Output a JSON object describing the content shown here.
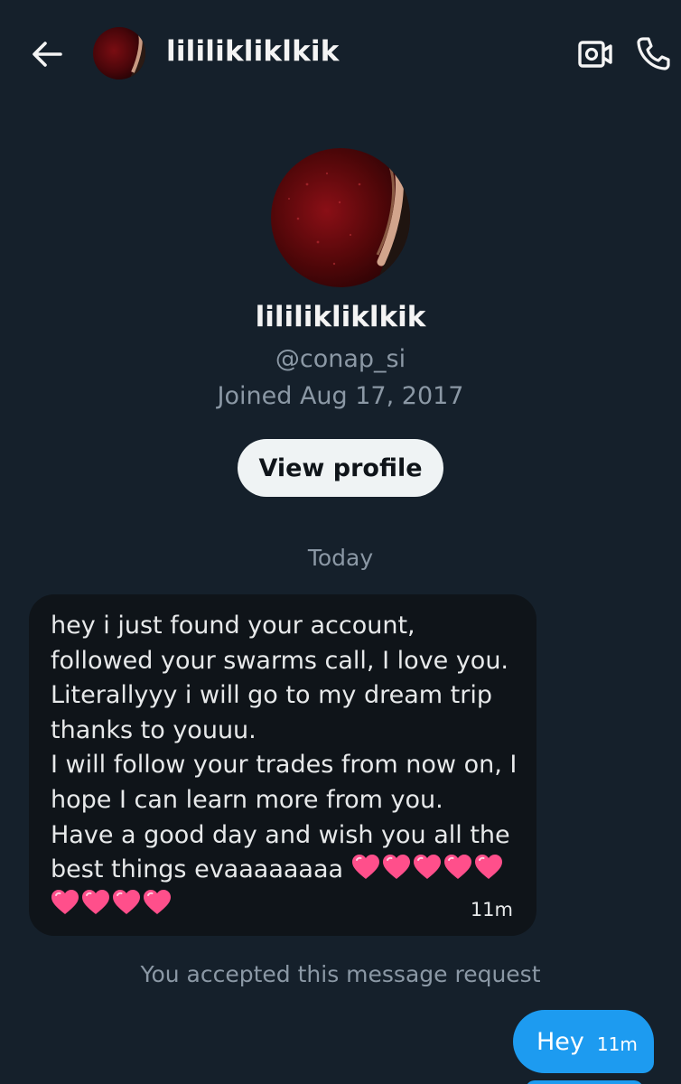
{
  "header": {
    "back_icon": "arrow-left-icon",
    "name": "lililikliklkik",
    "video_icon": "video-camera-icon",
    "call_icon": "phone-icon"
  },
  "profile": {
    "name": "lililikliklkik",
    "handle": "@conap_si",
    "joined": "Joined Aug 17, 2017",
    "view_profile_label": "View profile"
  },
  "conversation": {
    "date_separator": "Today",
    "received_message": {
      "lines": [
        "hey i just found your account,",
        "followed your swarms call, I love you.",
        "Literallyyy i will go to my dream trip",
        "thanks to youuu.",
        "I will follow your trades from now on, I",
        "hope I can learn more from you.",
        "Have a good day and wish you all the",
        "best things evaaaaaaaa"
      ],
      "inline_hearts": 5,
      "trailing_hearts": 4,
      "heart_icon": "pink-heart-emoji",
      "time": "11m"
    },
    "system_note": "You accepted this message request",
    "sent_message": {
      "text": "Hey",
      "time": "11m"
    }
  },
  "colors": {
    "background": "#15202b",
    "received_bubble": "#0f1419",
    "sent_bubble": "#1d9bf0",
    "secondary_text": "#8b98a5",
    "button_bg": "#eff3f4",
    "heart": "#ff4f8b"
  }
}
